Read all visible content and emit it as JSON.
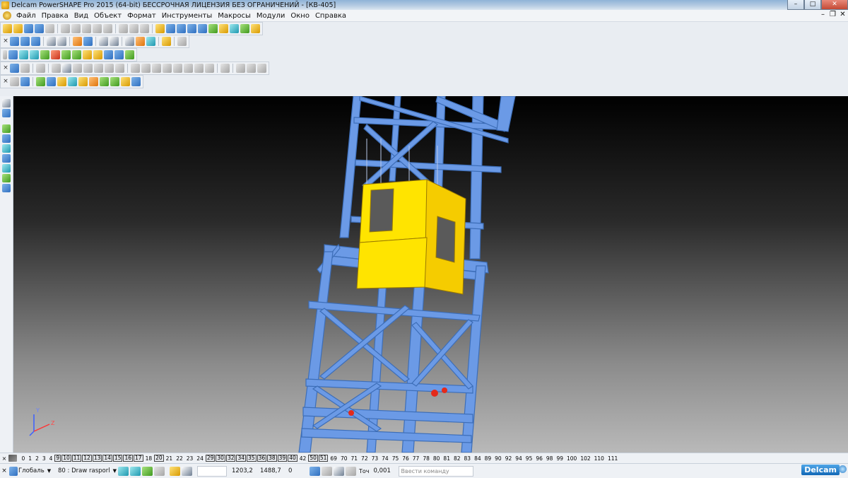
{
  "window": {
    "title": "Delcam PowerSHAPE Pro 2015 (64-bit) БЕССРОЧНАЯ ЛИЦЕНЗИЯ БЕЗ ОГРАНИЧЕНИЙ - [КВ-405]",
    "minimize": "–",
    "maximize": "□",
    "close": "✕"
  },
  "menu": {
    "items": [
      {
        "label": "Файл"
      },
      {
        "label": "Правка"
      },
      {
        "label": "Вид"
      },
      {
        "label": "Объект"
      },
      {
        "label": "Формат"
      },
      {
        "label": "Инструменты"
      },
      {
        "label": "Макросы"
      },
      {
        "label": "Модули"
      },
      {
        "label": "Окно"
      },
      {
        "label": "Справка"
      }
    ],
    "doc_minimize": "–",
    "doc_restore": "❐",
    "doc_close": "✕"
  },
  "toolbars": {
    "close_glyph": "×"
  },
  "viewport": {
    "axis_x_label": "Z",
    "axis_y_label": "Y"
  },
  "levels": {
    "items": [
      {
        "label": "0",
        "on": false
      },
      {
        "label": "1",
        "on": false
      },
      {
        "label": "2",
        "on": false
      },
      {
        "label": "3",
        "on": false
      },
      {
        "label": "4",
        "on": false
      },
      {
        "label": "9",
        "on": true
      },
      {
        "label": "10",
        "on": true
      },
      {
        "label": "11",
        "on": true
      },
      {
        "label": "12",
        "on": true
      },
      {
        "label": "13",
        "on": true
      },
      {
        "label": "14",
        "on": true
      },
      {
        "label": "15",
        "on": true
      },
      {
        "label": "16",
        "on": true
      },
      {
        "label": "17",
        "on": true
      },
      {
        "label": "18",
        "on": false
      },
      {
        "label": "20",
        "on": true
      },
      {
        "label": "21",
        "on": false
      },
      {
        "label": "22",
        "on": false
      },
      {
        "label": "23",
        "on": false
      },
      {
        "label": "24",
        "on": false
      },
      {
        "label": "29",
        "on": true
      },
      {
        "label": "30",
        "on": true
      },
      {
        "label": "32",
        "on": true
      },
      {
        "label": "34",
        "on": true
      },
      {
        "label": "35",
        "on": true
      },
      {
        "label": "36",
        "on": true
      },
      {
        "label": "38",
        "on": true
      },
      {
        "label": "39",
        "on": true
      },
      {
        "label": "40",
        "on": true
      },
      {
        "label": "42",
        "on": false
      },
      {
        "label": "50",
        "on": true
      },
      {
        "label": "51",
        "on": true
      },
      {
        "label": "69",
        "on": false
      },
      {
        "label": "70",
        "on": false
      },
      {
        "label": "71",
        "on": false
      },
      {
        "label": "72",
        "on": false
      },
      {
        "label": "73",
        "on": false
      },
      {
        "label": "74",
        "on": false
      },
      {
        "label": "75",
        "on": false
      },
      {
        "label": "76",
        "on": false
      },
      {
        "label": "77",
        "on": false
      },
      {
        "label": "78",
        "on": false
      },
      {
        "label": "80",
        "on": false
      },
      {
        "label": "81",
        "on": false
      },
      {
        "label": "82",
        "on": false
      },
      {
        "label": "83",
        "on": false
      },
      {
        "label": "84",
        "on": false
      },
      {
        "label": "89",
        "on": false
      },
      {
        "label": "90",
        "on": false
      },
      {
        "label": "92",
        "on": false
      },
      {
        "label": "94",
        "on": false
      },
      {
        "label": "95",
        "on": false
      },
      {
        "label": "96",
        "on": false
      },
      {
        "label": "98",
        "on": false
      },
      {
        "label": "99",
        "on": false
      },
      {
        "label": "100",
        "on": false
      },
      {
        "label": "102",
        "on": false
      },
      {
        "label": "110",
        "on": false
      },
      {
        "label": "111",
        "on": false
      }
    ]
  },
  "status": {
    "workplane": "Глобаль",
    "level": "80 : Draw rasporl",
    "coord_x": "1203,2",
    "coord_y": "1488,7",
    "coord_z": "0",
    "tolerance_label": "Точ",
    "tolerance": "0,001",
    "command_placeholder": "Ввести команду",
    "brand": "Delcam"
  }
}
